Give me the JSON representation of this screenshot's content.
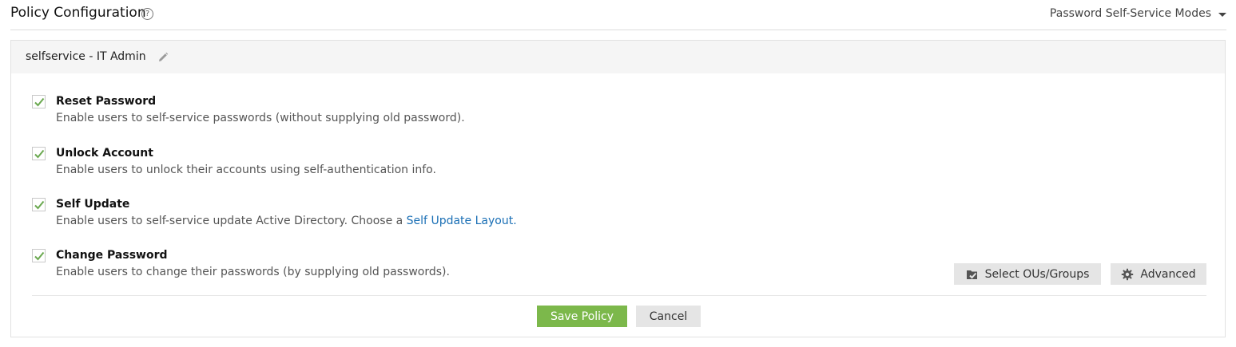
{
  "header": {
    "title": "Policy Configuration",
    "help_symbol": "?",
    "modes_label": "Password Self-Service Modes"
  },
  "policy": {
    "name": "selfservice - IT Admin"
  },
  "options": [
    {
      "title": "Reset Password",
      "description": "Enable users to self-service passwords (without supplying old password).",
      "checked": true
    },
    {
      "title": "Unlock Account",
      "description": "Enable users to unlock their accounts using self-authentication info.",
      "checked": true
    },
    {
      "title": "Self Update",
      "description_prefix": "Enable users to self-service update Active Directory. Choose a ",
      "link": "Self Update Layout",
      "description_suffix": ".",
      "checked": true
    },
    {
      "title": "Change Password",
      "description": "Enable users to change their passwords (by supplying old passwords).",
      "checked": true
    }
  ],
  "buttons": {
    "select_ous": "Select OUs/Groups",
    "advanced": "Advanced",
    "save": "Save Policy",
    "cancel": "Cancel"
  },
  "colors": {
    "accent_green": "#7cb84b",
    "link_blue": "#1a6fb5",
    "check_green": "#6aa84f"
  },
  "icons": {
    "help": "help-circle-icon",
    "caret": "caret-down-icon",
    "edit": "pencil-icon",
    "check": "check-icon",
    "select_ous": "folder-check-icon",
    "advanced": "gear-icon"
  }
}
